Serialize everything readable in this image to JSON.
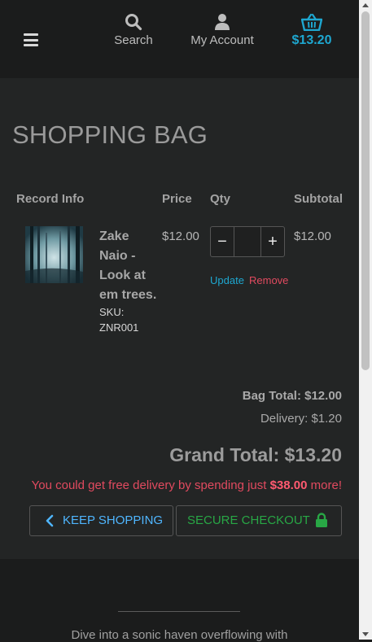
{
  "header": {
    "search_label": "Search",
    "account_label": "My Account",
    "bag_total": "$13.20"
  },
  "page_title": "SHOPPING BAG",
  "table": {
    "headers": {
      "info": "Record Info",
      "price": "Price",
      "qty": "Qty",
      "subtotal": "Subtotal"
    },
    "item": {
      "title": "Zake Naio - Look at em trees.",
      "sku": "SKU: ZNR001",
      "price": "$12.00",
      "qty": "",
      "subtotal": "$12.00",
      "update_label": "Update",
      "remove_label": "Remove"
    }
  },
  "totals": {
    "bag_total": "Bag Total: $12.00",
    "delivery": "Delivery: $1.20",
    "grand_total": "Grand Total: $13.20",
    "promo_prefix": "You could get free delivery by spending just ",
    "promo_amount": "$38.00",
    "promo_suffix": " more!"
  },
  "buttons": {
    "keep_shopping": "KEEP SHOPPING",
    "secure_checkout": "SECURE CHECKOUT"
  },
  "footer": {
    "blurb": "Dive into a sonic haven overflowing with"
  },
  "colors": {
    "accent": "#1ea7d0",
    "danger": "#e14a5f",
    "success": "#28a745",
    "link_blue": "#4fb6ff"
  },
  "icons": [
    "menu-icon",
    "search-icon",
    "user-icon",
    "basket-icon",
    "chevron-left-icon",
    "lock-icon"
  ]
}
